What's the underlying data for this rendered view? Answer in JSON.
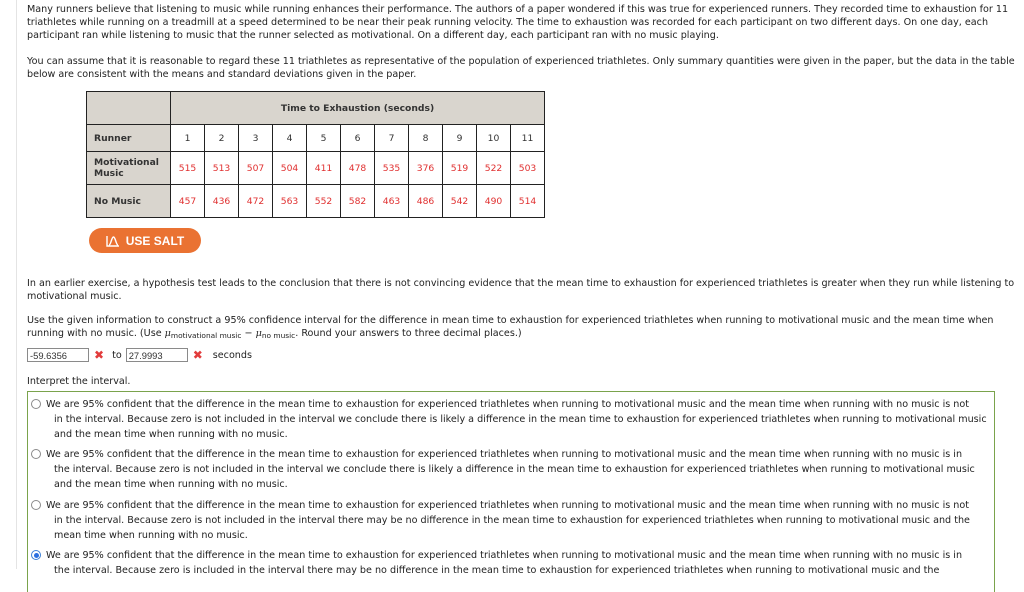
{
  "intro": {
    "paragraph1": "Many runners believe that listening to music while running enhances their performance. The authors of a paper wondered if this was true for experienced runners. They recorded time to exhaustion for 11 triathletes while running on a treadmill at a speed determined to be near their peak running velocity. The time to exhaustion was recorded for each participant on two different days. On one day, each participant ran while listening to music that the runner selected as motivational. On a different day, each participant ran with no music playing.",
    "paragraph2": "You can assume that it is reasonable to regard these 11 triathletes as representative of the population of experienced triathletes. Only summary quantities were given in the paper, but the data in the table below are consistent with the means and standard deviations given in the paper."
  },
  "table": {
    "group_header": "Time to Exhaustion (seconds)",
    "row_label_runner": "Runner",
    "runners": [
      "1",
      "2",
      "3",
      "4",
      "5",
      "6",
      "7",
      "8",
      "9",
      "10",
      "11"
    ],
    "rows": [
      {
        "label_line1": "Motivational",
        "label_line2": "Music",
        "values": [
          "515",
          "513",
          "507",
          "504",
          "411",
          "478",
          "535",
          "376",
          "519",
          "522",
          "503"
        ]
      },
      {
        "label_line1": "No Music",
        "label_line2": "",
        "values": [
          "457",
          "436",
          "472",
          "563",
          "552",
          "582",
          "463",
          "486",
          "542",
          "490",
          "514"
        ]
      }
    ]
  },
  "salt_button": {
    "label": "USE SALT",
    "icon": "salt-curve-icon",
    "color": "#ea7232"
  },
  "question": {
    "paragraph3": "In an earlier exercise, a hypothesis test leads to the conclusion that there is not convincing evidence that the mean time to exhaustion for experienced triathletes is greater when they run while listening to motivational music.",
    "paragraph4_part1": "Use the given information to construct a 95% confidence interval for the difference in mean time to exhaustion for experienced triathletes when running to motivational music and the mean time when running with no music. (Use ",
    "mu_symbol": "μ",
    "sub_motivational": "motivational music",
    "minus": " − ",
    "sub_no_music": "no music",
    "paragraph4_part2": ". Round your answers to three decimal places.)"
  },
  "answer": {
    "lower_value": "-59.6356",
    "lower_status": "incorrect",
    "to_label": "to",
    "upper_value": "27.9993",
    "upper_status": "incorrect",
    "units_label": "seconds",
    "incorrect_mark": "✖",
    "incorrect_color": "#e23c3c"
  },
  "interpret": {
    "prompt": "Interpret the interval.",
    "options": [
      {
        "selected": false,
        "line1": "We are 95% confident that the difference in the mean time to exhaustion for experienced triathletes when running to motivational music and the mean time when running with no music is not",
        "rest": "in the interval. Because zero is not included in the interval we conclude there is likely a difference in the mean time to exhaustion for experienced triathletes when running to motivational music and the mean time when running with no music."
      },
      {
        "selected": false,
        "line1": "We are 95% confident that the difference in the mean time to exhaustion for experienced triathletes when running to motivational music and the mean time when running with no music is in",
        "rest": "the interval. Because zero is not included in the interval we conclude there is likely a difference in the mean time to exhaustion for experienced triathletes when running to motivational music and the mean time when running with no music."
      },
      {
        "selected": false,
        "line1": "We are 95% confident that the difference in the mean time to exhaustion for experienced triathletes when running to motivational music and the mean time when running with no music is not",
        "rest": "in the interval. Because zero is not included in the interval there may be no difference in the mean time to exhaustion for experienced triathletes when running to motivational music and the mean time when running with no music."
      },
      {
        "selected": true,
        "line1": "We are 95% confident that the difference in the mean time to exhaustion for experienced triathletes when running to motivational music and the mean time when running with no music is in",
        "rest": "the interval. Because zero is included in the interval there may be no difference in the mean time to exhaustion for experienced triathletes when running to motivational music and the"
      }
    ]
  }
}
